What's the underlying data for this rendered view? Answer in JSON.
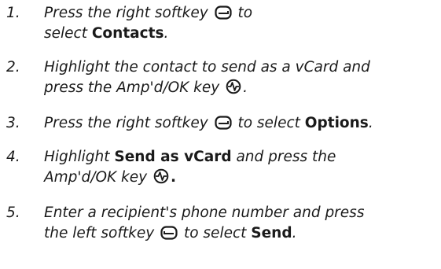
{
  "steps": [
    {
      "number": "1.",
      "line1_a": "Press the right softkey",
      "line1_b": "to",
      "line2_a": "select",
      "line2_bold": "Contacts",
      "line2_b": ".",
      "icon": "right-softkey-icon"
    },
    {
      "number": "2.",
      "line1": "Highlight the contact to send as a vCard and",
      "line2_a": "press the Amp'd/OK key",
      "line2_b": ".",
      "icon": "amp-ok-key-icon"
    },
    {
      "number": "3.",
      "text_a": "Press the right softkey",
      "text_b": "to select",
      "bold": "Options",
      "text_c": ".",
      "icon": "right-softkey-icon"
    },
    {
      "number": "4.",
      "line1_a": "Highlight",
      "line1_bold": "Send as vCard",
      "line1_b": "and press the",
      "line2_a": "Amp'd/OK key",
      "line2_b": ".",
      "icon": "amp-ok-key-icon"
    },
    {
      "number": "5.",
      "line1": "Enter a recipient's phone number and press",
      "line2_a": "the left softkey",
      "line2_b": "to select",
      "line2_bold": "Send",
      "line2_c": ".",
      "icon": "left-softkey-icon"
    }
  ]
}
